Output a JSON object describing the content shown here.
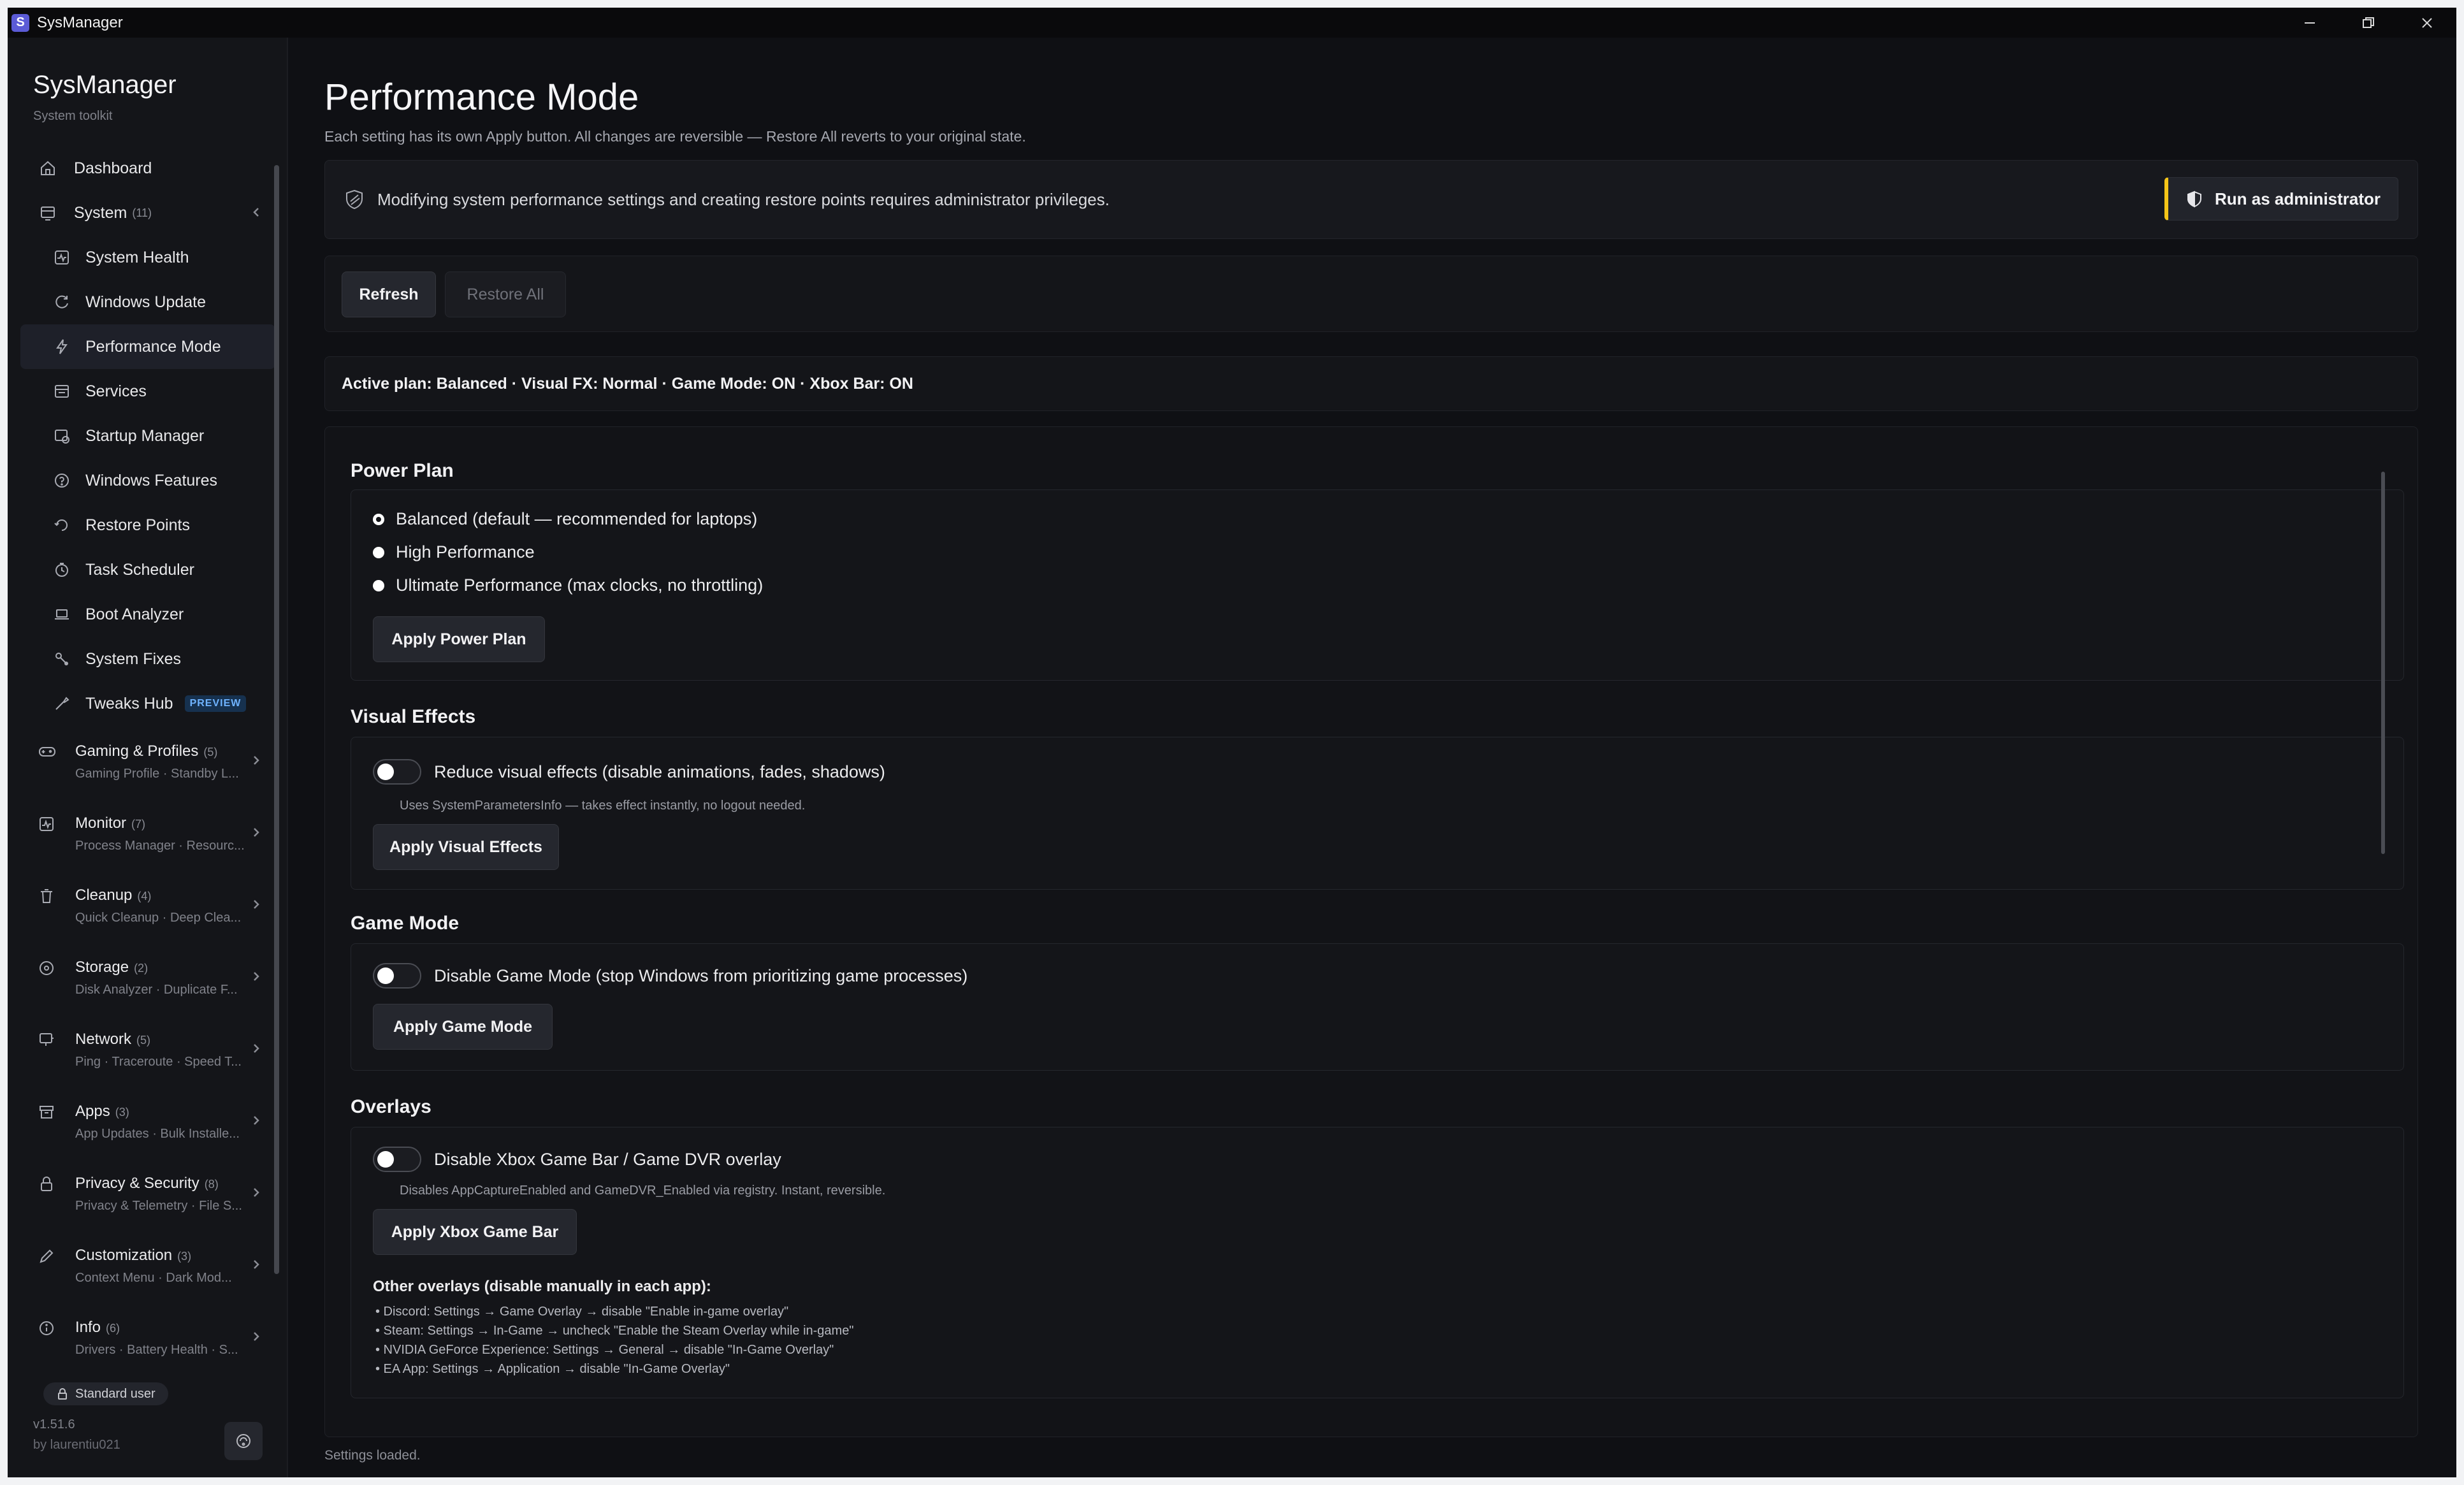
{
  "window": {
    "title": "SysManager",
    "app_icon_letter": "S"
  },
  "sidebar": {
    "brand": "SysManager",
    "tagline": "System toolkit",
    "dashboard": "Dashboard",
    "system_group": {
      "label": "System",
      "count": "(11)"
    },
    "system_items": [
      {
        "label": "System Health",
        "icon": "health-icon"
      },
      {
        "label": "Windows Update",
        "icon": "refresh-icon"
      },
      {
        "label": "Performance Mode",
        "icon": "lightning-icon",
        "active": true
      },
      {
        "label": "Services",
        "icon": "services-icon"
      },
      {
        "label": "Startup Manager",
        "icon": "startup-icon"
      },
      {
        "label": "Windows Features",
        "icon": "features-icon"
      },
      {
        "label": "Restore Points",
        "icon": "restore-icon"
      },
      {
        "label": "Task Scheduler",
        "icon": "clock-icon"
      },
      {
        "label": "Boot Analyzer",
        "icon": "laptop-icon"
      },
      {
        "label": "System Fixes",
        "icon": "wrench-icon"
      },
      {
        "label": "Tweaks Hub",
        "icon": "tweak-icon",
        "badge": "PREVIEW"
      }
    ],
    "groups": [
      {
        "title": "Gaming & Profiles",
        "count": "(5)",
        "subtitle": "Gaming Profile · Standby L...",
        "icon": "gamepad-icon"
      },
      {
        "title": "Monitor",
        "count": "(7)",
        "subtitle": "Process Manager · Resourc...",
        "icon": "monitor-icon"
      },
      {
        "title": "Cleanup",
        "count": "(4)",
        "subtitle": "Quick Cleanup · Deep Clea...",
        "icon": "trash-icon"
      },
      {
        "title": "Storage",
        "count": "(2)",
        "subtitle": "Disk Analyzer · Duplicate F...",
        "icon": "disk-icon"
      },
      {
        "title": "Network",
        "count": "(5)",
        "subtitle": "Ping · Traceroute · Speed T...",
        "icon": "network-icon"
      },
      {
        "title": "Apps",
        "count": "(3)",
        "subtitle": "App Updates · Bulk Installe...",
        "icon": "box-icon"
      },
      {
        "title": "Privacy & Security",
        "count": "(8)",
        "subtitle": "Privacy & Telemetry · File S...",
        "icon": "lock-icon"
      },
      {
        "title": "Customization",
        "count": "(3)",
        "subtitle": "Context Menu · Dark Mod...",
        "icon": "pencil-icon"
      },
      {
        "title": "Info",
        "count": "(6)",
        "subtitle": "Drivers · Battery Health · S...",
        "icon": "info-icon"
      }
    ],
    "user_badge": "Standard user",
    "version": "v1.51.6",
    "author": "by laurentiu021"
  },
  "main": {
    "title": "Performance Mode",
    "description": "Each setting has its own Apply button. All changes are reversible — Restore All reverts to your original state.",
    "admin_notice": "Modifying system performance settings and creating restore points requires administrator privileges.",
    "run_admin_label": "Run as administrator",
    "refresh_label": "Refresh",
    "restore_all_label": "Restore All",
    "status_summary": "Active plan: Balanced · Visual FX: Normal · Game Mode: ON · Xbox Bar: ON",
    "power_plan": {
      "title": "Power Plan",
      "options": [
        {
          "label": "Balanced (default — recommended for laptops)",
          "checked": true
        },
        {
          "label": "High Performance",
          "checked": false
        },
        {
          "label": "Ultimate Performance (max clocks, no throttling)",
          "checked": false
        }
      ],
      "apply_label": "Apply Power Plan"
    },
    "visual_effects": {
      "title": "Visual Effects",
      "toggle_label": "Reduce visual effects (disable animations, fades, shadows)",
      "toggle_on": false,
      "hint": "Uses SystemParametersInfo — takes effect instantly, no logout needed.",
      "apply_label": "Apply Visual Effects"
    },
    "game_mode": {
      "title": "Game Mode",
      "toggle_label": "Disable Game Mode (stop Windows from prioritizing game processes)",
      "toggle_on": false,
      "apply_label": "Apply Game Mode"
    },
    "overlays": {
      "title": "Overlays",
      "toggle_label": "Disable Xbox Game Bar / Game DVR overlay",
      "toggle_on": false,
      "hint": "Disables AppCaptureEnabled and GameDVR_Enabled via registry. Instant, reversible.",
      "apply_label": "Apply Xbox Game Bar",
      "other_title": "Other overlays (disable manually in each app):",
      "other_lines": [
        "• Discord: Settings → Game Overlay → disable \"Enable in-game overlay\"",
        "• Steam: Settings → In-Game → uncheck \"Enable the Steam Overlay while in-game\"",
        "• NVIDIA GeForce Experience: Settings → General → disable \"In-Game Overlay\"",
        "• EA App: Settings → Application → disable \"In-Game Overlay\""
      ]
    },
    "footer_status": "Settings loaded."
  },
  "colors": {
    "accent_warning": "#f5c518",
    "preview_badge": "#6fb3ff",
    "background": "#0f1014"
  }
}
